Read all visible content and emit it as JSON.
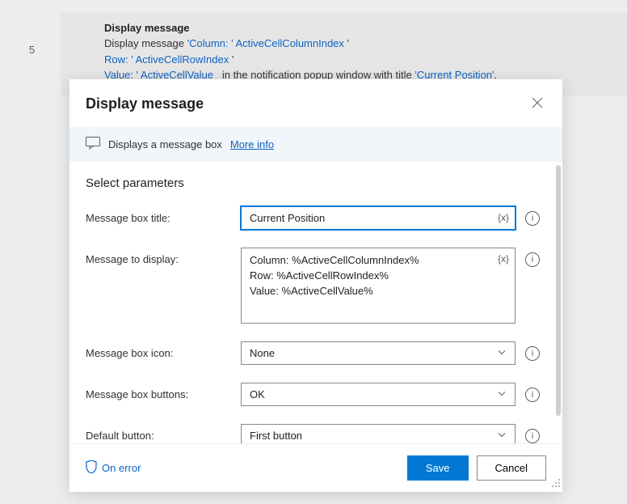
{
  "step": {
    "number": "5",
    "title": "Display message",
    "body_prefix": "Display message",
    "line1_lit1": "'Column: '",
    "line1_var1": "ActiveCellColumnIndex",
    "line2_lit": "Row: '",
    "line2_var": "ActiveCellRowIndex",
    "line3_lit": "Value: '",
    "line3_var": "ActiveCellValue",
    "body_mid": "in the notification popup window with title",
    "body_title_lit": "'Current Position'",
    "body_end": "."
  },
  "modal": {
    "title": "Display message",
    "banner_text": "Displays a message box",
    "more_info": "More info",
    "section": "Select parameters",
    "fields": {
      "title_label": "Message box title:",
      "title_value": "Current Position",
      "message_label": "Message to display:",
      "message_value": "Column: %ActiveCellColumnIndex%\nRow: %ActiveCellRowIndex%\nValue: %ActiveCellValue%",
      "icon_label": "Message box icon:",
      "icon_value": "None",
      "buttons_label": "Message box buttons:",
      "buttons_value": "OK",
      "default_label": "Default button:",
      "default_value": "First button"
    },
    "var_chip": "{x}",
    "info_glyph": "i",
    "on_error": "On error",
    "save": "Save",
    "cancel": "Cancel"
  }
}
